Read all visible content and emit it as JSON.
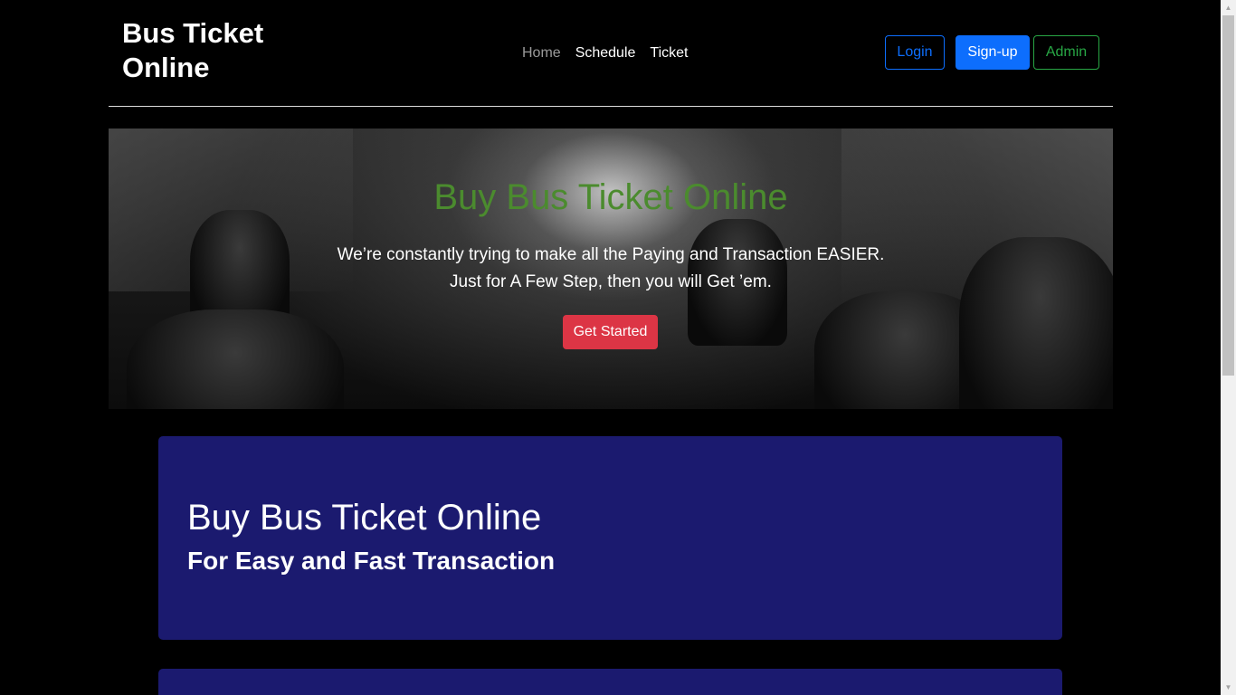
{
  "header": {
    "brand": "Bus Ticket Online",
    "nav": [
      {
        "label": "Home"
      },
      {
        "label": "Schedule"
      },
      {
        "label": "Ticket"
      }
    ],
    "login_label": "Login",
    "signup_label": "Sign-up",
    "admin_label": "Admin"
  },
  "hero": {
    "title": "Buy Bus Ticket Online",
    "text": "We’re constantly trying to make all the Paying and Transaction EASIER. Just for A Few Step, then you will Get ’em.",
    "cta_label": "Get Started"
  },
  "cards": [
    {
      "title": "Buy Bus Ticket Online",
      "subtitle": "For Easy and Fast Transaction"
    }
  ],
  "colors": {
    "background": "#000000",
    "hero_title": "#4b8b2e",
    "card_bg": "#1b1a6f",
    "primary": "#0d6efd",
    "success": "#28a745",
    "danger": "#dc3545"
  }
}
